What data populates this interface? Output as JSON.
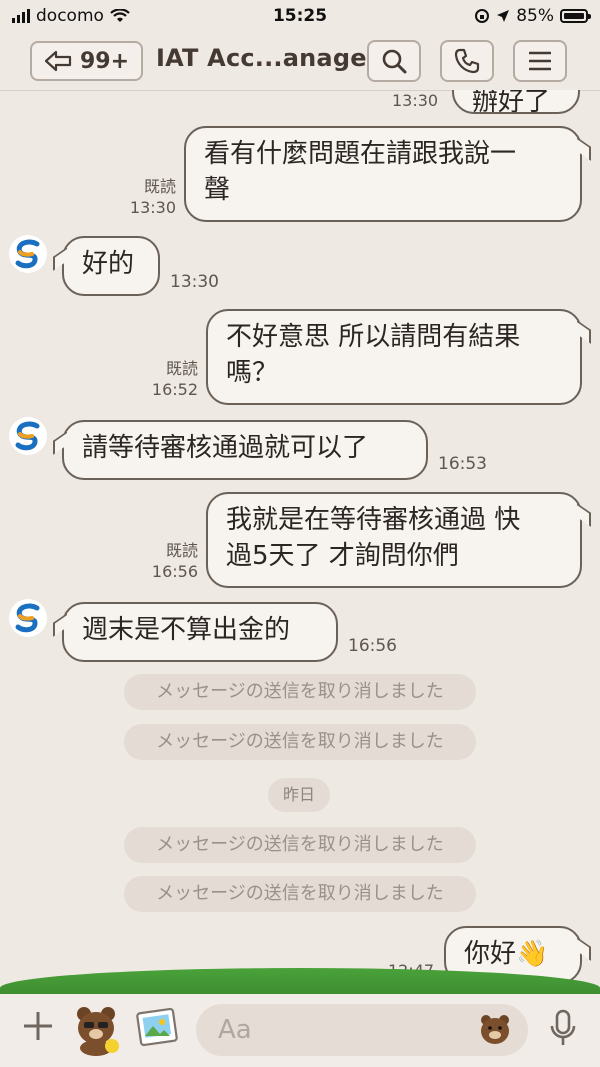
{
  "status": {
    "carrier": "docomo",
    "time": "15:25",
    "battery": "85%"
  },
  "header": {
    "unread": "99+",
    "title": "IAT Acc...anager"
  },
  "messages": {
    "top_partial": {
      "time": "13:30",
      "text": "辦好了"
    },
    "m1": {
      "text": "看有什麼問題在請跟我說一聲",
      "line1": "看有什麼問題在請跟我說一",
      "line2": "聲",
      "read": "既読",
      "time": "13:30"
    },
    "m2": {
      "text": "好的",
      "time": "13:30"
    },
    "m3": {
      "line1": "不好意思 所以請問有結果",
      "line2": "嗎？",
      "read": "既読",
      "time": "16:52"
    },
    "m4": {
      "text": "請等待審核通過就可以了",
      "time": "16:53"
    },
    "m5": {
      "line1": "我就是在等待審核通過 快",
      "line2": "過5天了 才詢問你們",
      "read": "既読",
      "time": "16:56"
    },
    "m6": {
      "text": "週末是不算出金的",
      "time": "16:56"
    },
    "unsent": "メッセージの送信を取り消しました",
    "date_chip": "昨日",
    "m7": {
      "text": "你好",
      "emoji": "👋",
      "time": "12:47"
    }
  },
  "input": {
    "placeholder": "Aa"
  },
  "icons": [
    "back-arrow-icon",
    "search-icon",
    "phone-icon",
    "menu-icon",
    "plus-icon",
    "sticker-icon",
    "image-icon",
    "emoji-icon",
    "mic-icon"
  ]
}
